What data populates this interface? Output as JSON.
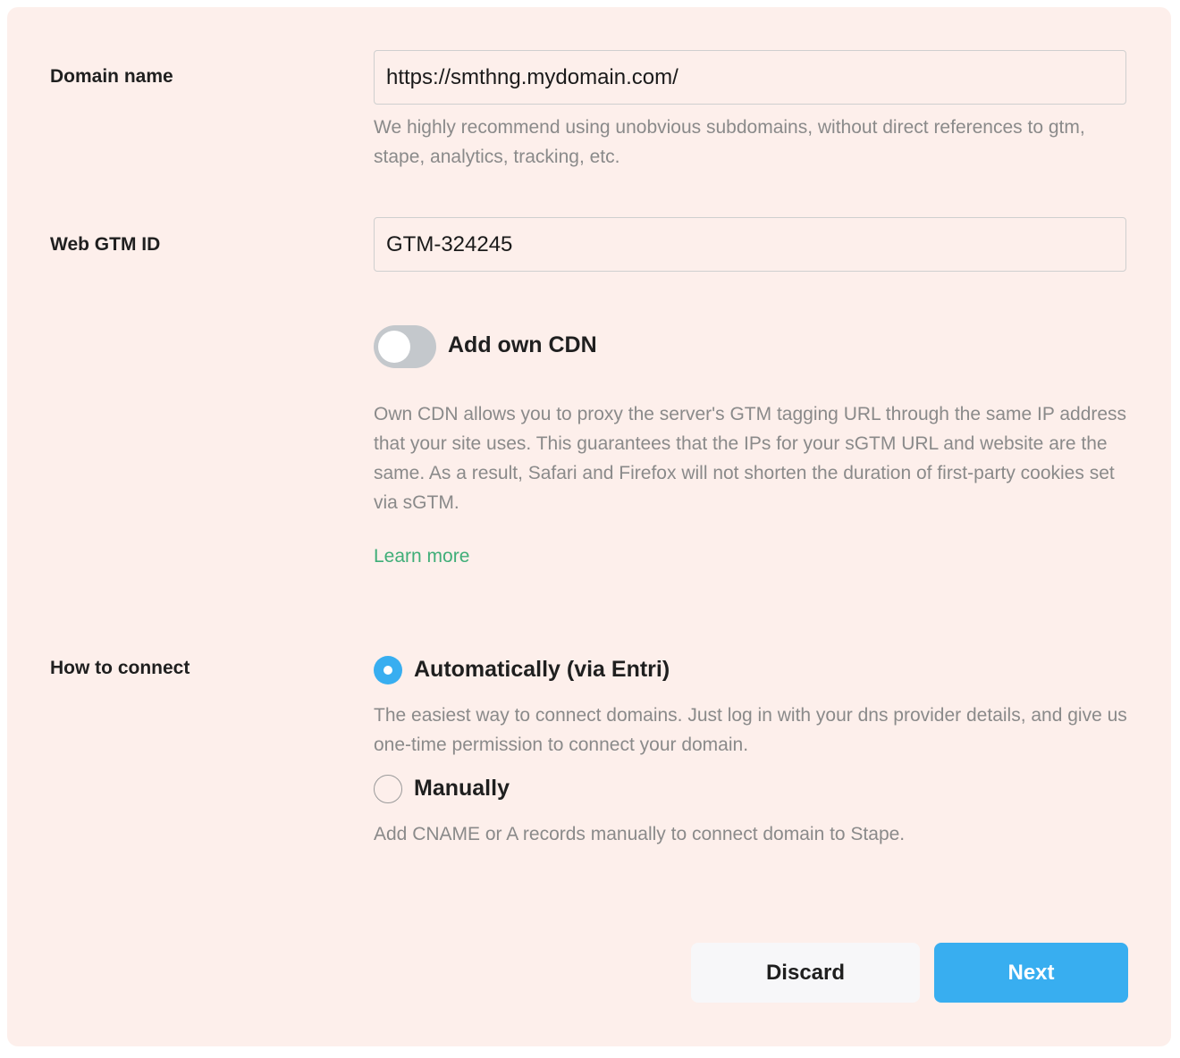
{
  "domain": {
    "label": "Domain name",
    "value": "https://smthng.mydomain.com/",
    "hint": "We highly recommend using unobvious subdomains, without direct references to gtm, stape, analytics, tracking, etc."
  },
  "gtm": {
    "label": "Web GTM ID",
    "value": "GTM-324245"
  },
  "cdn": {
    "toggle_label": "Add own CDN",
    "enabled": false,
    "description": "Own CDN allows you to proxy the server's GTM tagging URL through the same IP address that your site uses. This guarantees that the IPs for your sGTM URL and website are the same. As a result, Safari and Firefox will not shorten the duration of first-party cookies set via sGTM.",
    "learn_more": "Learn more"
  },
  "connect": {
    "label": "How to connect",
    "options": [
      {
        "label": "Automatically (via Entri)",
        "description": "The easiest way to connect domains. Just log in with your dns provider details, and give us one-time permission to connect your domain.",
        "selected": true
      },
      {
        "label": "Manually",
        "description": "Add CNAME or A records manually to connect domain to Stape.",
        "selected": false
      }
    ]
  },
  "actions": {
    "discard": "Discard",
    "next": "Next"
  },
  "colors": {
    "background": "#fdefeb",
    "accent": "#38aef0",
    "link": "#3fae78",
    "toggle_off": "#c4c8cc"
  }
}
